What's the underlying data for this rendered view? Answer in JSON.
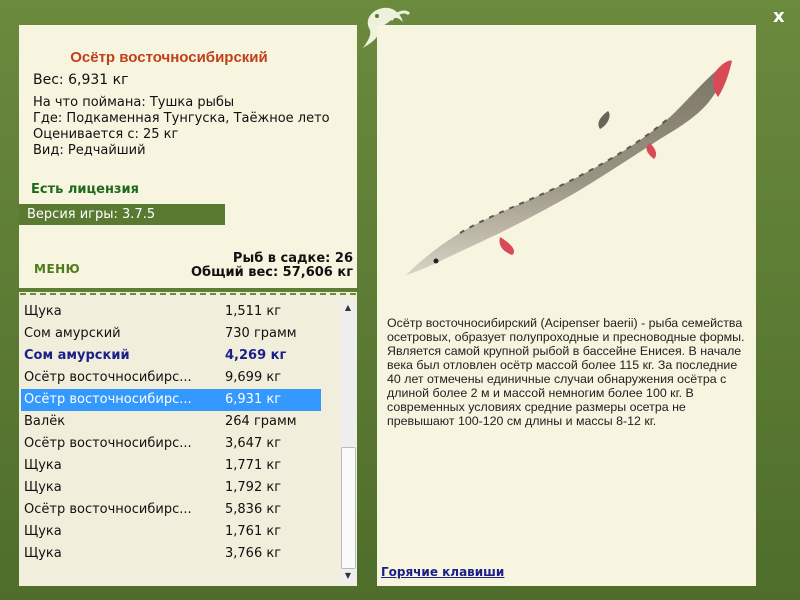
{
  "fish": {
    "name": "Осётр восточносибирский",
    "weight": "Вес: 6,931 кг",
    "caught_with": "На что поймана: Тушка рыбы",
    "where": "Где: Подкаменная Тунгуска, Таёжное лето",
    "valued_from": "Оценивается с: 25 кг",
    "kind": "Вид: Редчайший",
    "license": "Есть лицензия",
    "description": "Осётр восточносибирский (Acipenser baerii) - рыба семейства осетровых, образует полупроходные и пресноводные формы. Является самой крупной рыбой в бассейне Енисея. В начале века был отловлен осётр массой более 115 кг. За последние 40 лет отмечены единичные случаи обнаружения осётра с длиной более 2 м и массой немногим более 100 кг. В современных условиях средние размеры осетра не превышают 100-120 см длины и массы 8-12 кг."
  },
  "version": "Версия игры: 3.7.5",
  "menu_label": "МЕНЮ",
  "stats": {
    "fish_in_keepnet": "Рыб в садке: 26",
    "total_weight": "Общий вес: 57,606 кг"
  },
  "catch_list": [
    {
      "name": "Щука",
      "weight": "1,511 кг",
      "style": ""
    },
    {
      "name": "Сом амурский",
      "weight": "730 грамм",
      "style": ""
    },
    {
      "name": "Сом амурский",
      "weight": "4,269 кг",
      "style": "bold"
    },
    {
      "name": "Осётр восточносибирс...",
      "weight": "9,699 кг",
      "style": ""
    },
    {
      "name": "Осётр восточносибирс...",
      "weight": "6,931 кг",
      "style": "sel"
    },
    {
      "name": "Валёк",
      "weight": "264 грамм",
      "style": ""
    },
    {
      "name": "Осётр восточносибирс...",
      "weight": "3,647 кг",
      "style": ""
    },
    {
      "name": "Щука",
      "weight": "1,771 кг",
      "style": ""
    },
    {
      "name": "Щука",
      "weight": "1,792 кг",
      "style": ""
    },
    {
      "name": "Осётр восточносибирс...",
      "weight": "5,836 кг",
      "style": ""
    },
    {
      "name": "Щука",
      "weight": "1,761 кг",
      "style": ""
    },
    {
      "name": "Щука",
      "weight": "3,766 кг",
      "style": ""
    }
  ],
  "hotkeys_label": "Горячие клавиши",
  "close_label": "x",
  "colors": {
    "frame": "#5a7a32",
    "panel": "#f7f4df",
    "title": "#c0401a",
    "selected": "#3399ff",
    "highlight_text": "#1a1f8a"
  }
}
